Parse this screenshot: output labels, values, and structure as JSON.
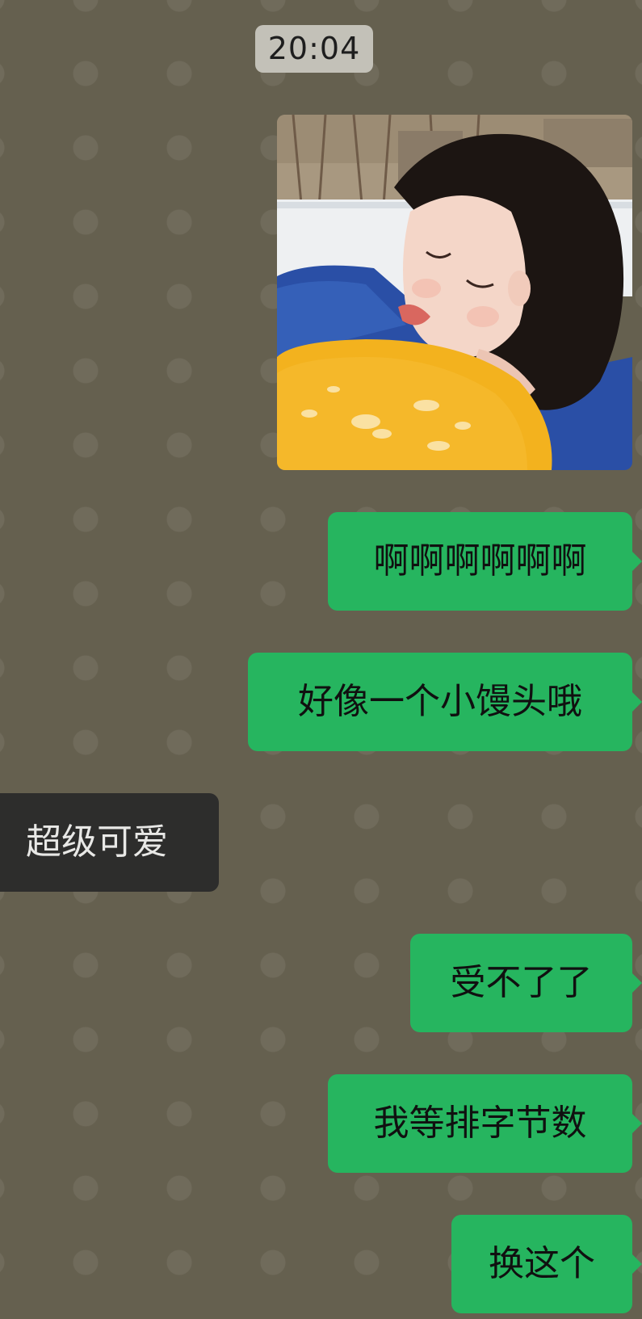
{
  "chat": {
    "timestamp": "20:04",
    "photo": {
      "description_icon": "image-icon",
      "colors": {
        "sweater": "#2a4fa6",
        "bread": "#f3b21e",
        "snow": "#eef0f2",
        "hair": "#1c1512",
        "skin": "#f4d6c8"
      }
    },
    "messages": [
      {
        "side": "out",
        "text": "啊啊啊啊啊啊"
      },
      {
        "side": "out",
        "text": "好像一个小馒头哦"
      },
      {
        "side": "in",
        "text": "超级可爱"
      },
      {
        "side": "out",
        "text": "受不了了"
      },
      {
        "side": "out",
        "text": "我等排字节数"
      },
      {
        "side": "out",
        "text": "换这个"
      }
    ]
  },
  "theme": {
    "background": "#65604f",
    "outgoing_bubble": "#26b55f",
    "incoming_bubble": "#2d2d2c",
    "time_badge": "#c3c1b8"
  }
}
